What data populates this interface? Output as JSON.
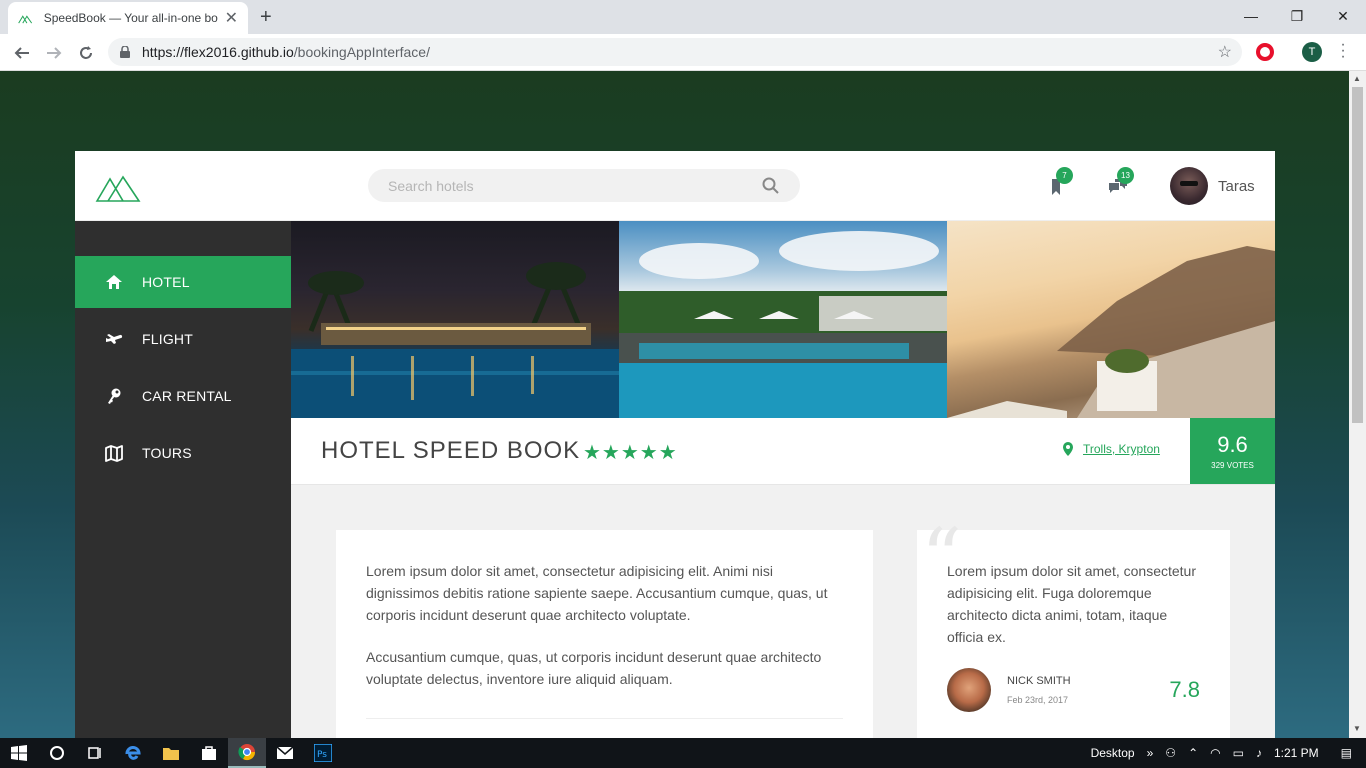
{
  "browser": {
    "tab_title": "SpeedBook — Your all-in-one bo",
    "close_tab": "✕",
    "new_tab": "+",
    "url_host": "https://flex2016.github.io",
    "url_path": "/bookingAppInterface/",
    "profile_initial": "T",
    "window_controls": {
      "minimize": "—",
      "restore": "❐",
      "close": "✕"
    }
  },
  "header": {
    "search_placeholder": "Search hotels",
    "bookmarks_count": "7",
    "messages_count": "13",
    "user_name": "Taras"
  },
  "sidebar": {
    "items": [
      {
        "label": "HOTEL",
        "icon": "home-icon",
        "active": true
      },
      {
        "label": "FLIGHT",
        "icon": "plane-icon",
        "active": false
      },
      {
        "label": "CAR RENTAL",
        "icon": "key-icon",
        "active": false
      },
      {
        "label": "TOURS",
        "icon": "map-icon",
        "active": false
      }
    ]
  },
  "hotel": {
    "name": "HOTEL SPEED BOOK",
    "stars": "★★★★★",
    "location": "Trolls, Krypton",
    "score": "9.6",
    "votes": "329 VOTES"
  },
  "description": {
    "paragraph1": "Lorem ipsum dolor sit amet, consectetur adipisicing elit. Animi nisi dignissimos debitis ratione sapiente saepe. Accusantium cumque, quas, ut corporis incidunt deserunt quae architecto voluptate.",
    "paragraph2": "Accusantium cumque, quas, ut corporis incidunt deserunt quae architecto voluptate delectus, inventore iure aliquid aliquam."
  },
  "review": {
    "quote_mark": "“",
    "text": "Lorem ipsum dolor sit amet, consectetur adipisicing elit. Fuga doloremque architecto dicta animi, totam, itaque officia ex.",
    "author": "NICK SMITH",
    "date": "Feb 23rd, 2017",
    "score": "7.8"
  },
  "taskbar": {
    "desktop_label": "Desktop",
    "chevron": "»",
    "time": "1:21 PM"
  },
  "colors": {
    "accent": "#26a65b",
    "sidebar_bg": "#2f2f2f",
    "page_bg": "#f1f1f1"
  }
}
